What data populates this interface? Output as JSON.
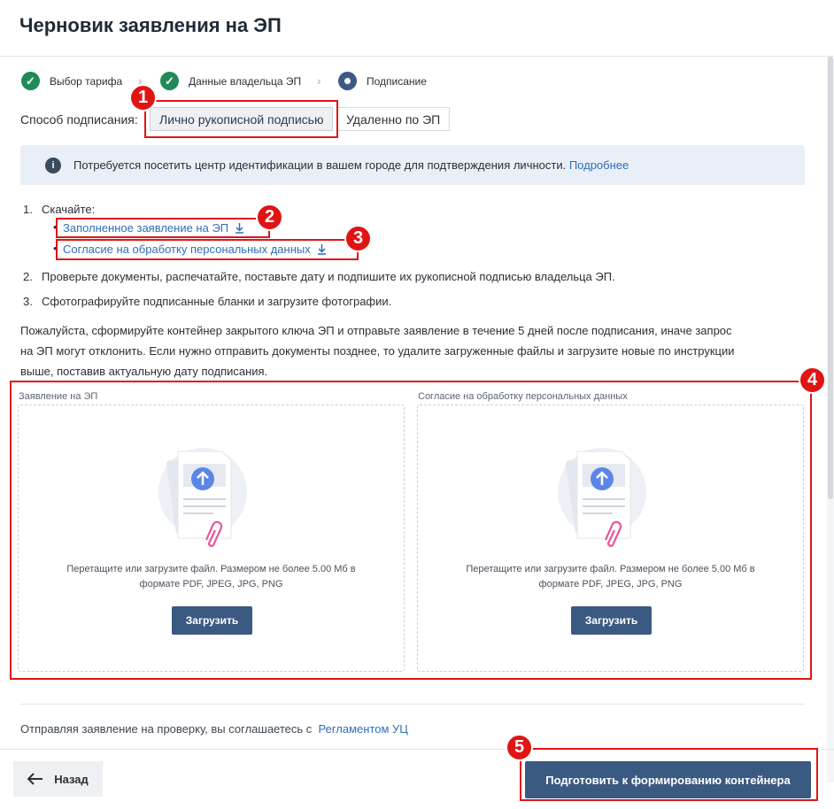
{
  "page_title": "Черновик заявления на ЭП",
  "stepper": {
    "steps": [
      {
        "label": "Выбор тарифа",
        "state": "done"
      },
      {
        "label": "Данные владельца ЭП",
        "state": "done"
      },
      {
        "label": "Подписание",
        "state": "active"
      }
    ]
  },
  "signing": {
    "label": "Способ подписания:",
    "options": [
      "Лично рукописной подписью",
      "Удаленно по ЭП"
    ],
    "selected": "Лично рукописной подписью"
  },
  "info_banner": {
    "text": "Потребуется посетить центр идентификации в вашем городе для подтверждения личности.",
    "link": "Подробнее"
  },
  "instructions": {
    "step1": {
      "num": "1.",
      "text": "Скачайте:"
    },
    "downloads": [
      "Заполненное заявление на ЭП",
      "Согласие на обработку персональных данных"
    ],
    "step2": {
      "num": "2.",
      "text": "Проверьте документы, распечатайте, поставьте дату и подпишите их рукописной подписью владельца ЭП."
    },
    "step3": {
      "num": "3.",
      "text": "Сфотографируйте подписанные бланки и загрузите фотографии."
    },
    "note_lines": [
      "Пожалуйста, сформируйте контейнер закрытого ключа ЭП и отправьте заявление в течение 5 дней после подписания, иначе запрос",
      "на ЭП могут отклонить. Если нужно отправить документы позднее, то удалите загруженные файлы и загрузите новые по инструкции",
      "выше, поставив актуальную дату подписания."
    ]
  },
  "uploads": [
    {
      "caption": "Заявление на ЭП",
      "hint_line1": "Перетащите или загрузите файл. Размером не более 5.00 Мб в",
      "hint_line2": "формате PDF, JPEG, JPG, PNG",
      "button": "Загрузить"
    },
    {
      "caption": "Согласие на обработку персональных данных",
      "hint_line1": "Перетащите или загрузите файл. Размером не более 5.00 Мб в",
      "hint_line2": "формате PDF, JPEG, JPG, PNG",
      "button": "Загрузить"
    }
  ],
  "footer": {
    "agree_text": "Отправляя заявление на проверку, вы соглашаетесь с",
    "agree_link": "Регламентом УЦ",
    "back_label": "Назад",
    "primary_label": "Подготовить к формированию контейнера"
  },
  "annotations": [
    "1",
    "2",
    "3",
    "4",
    "5"
  ],
  "colors": {
    "accent": "#3b5a82",
    "link": "#2e6fb8",
    "success": "#218a56",
    "annotation": "#e01414",
    "info_bg": "#e9eff7"
  },
  "icons": {
    "step_done": "check-icon",
    "step_active": "dot-icon",
    "info": "info-icon",
    "download": "download-icon",
    "upload": "upload-illustration-icon",
    "back": "arrow-left-icon"
  }
}
